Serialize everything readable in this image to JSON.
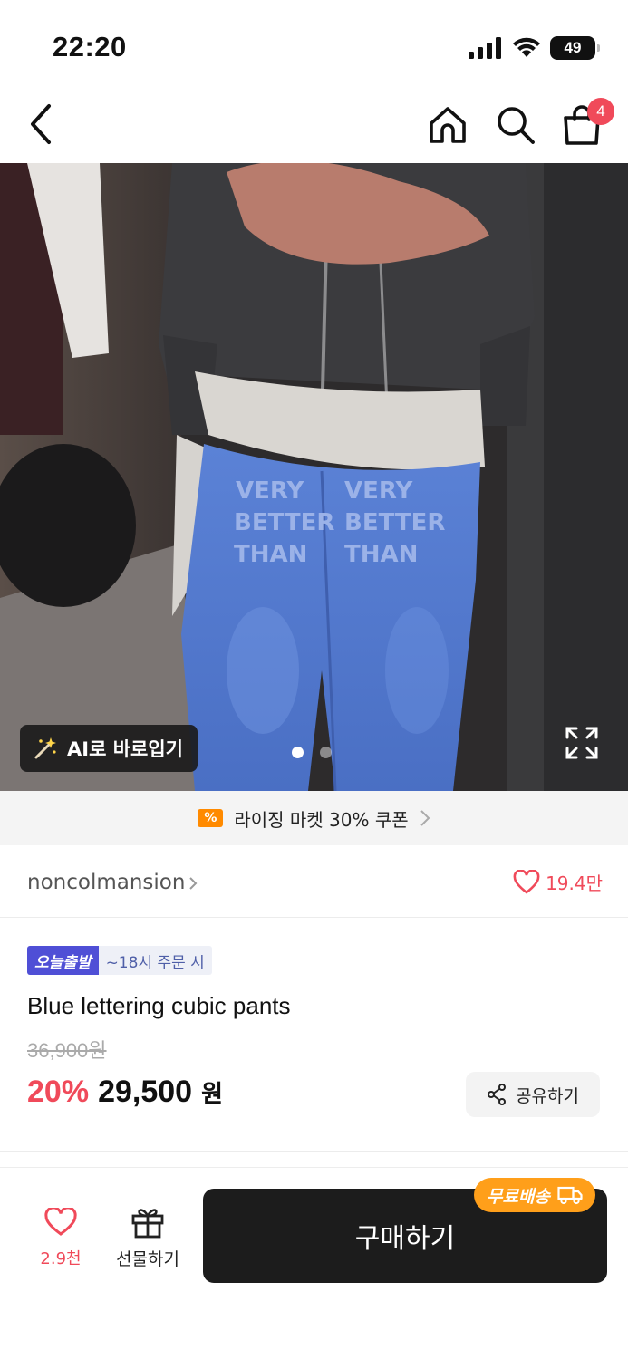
{
  "status_bar": {
    "time": "22:20",
    "battery": "49"
  },
  "nav": {
    "back_icon": "chevron-left",
    "home_icon": "home",
    "search_icon": "search",
    "cart_icon": "shopping-bag",
    "cart_count": "4"
  },
  "product_image": {
    "ai_button_icon": "magic-wand",
    "ai_button_label": "AI로 바로입기",
    "page_count": 2,
    "active_page": 1,
    "expand_icon": "expand"
  },
  "coupon_banner": {
    "icon": "%",
    "text": "라이징 마켓 30% 쿠폰"
  },
  "brand": {
    "name": "noncolmansion",
    "likes": "19.4만"
  },
  "product": {
    "delivery_badge": "오늘출발",
    "delivery_note": "~18시 주문 시",
    "title": "Blue lettering cubic pants",
    "original_price": "36,900원",
    "discount": "20%",
    "price": "29,500",
    "price_unit": "원",
    "share_label": "공유하기"
  },
  "bottom_bar": {
    "wish_count": "2.9천",
    "gift_label": "선물하기",
    "buy_label": "구매하기",
    "free_shipping_label": "무료배송"
  },
  "colors": {
    "accent_red": "#f04a5a",
    "buy_button": "#1c1c1c",
    "delivery_badge": "#4f4fd6",
    "free_shipping": "#ff9f1a",
    "coupon_icon": "#ff8a00"
  }
}
